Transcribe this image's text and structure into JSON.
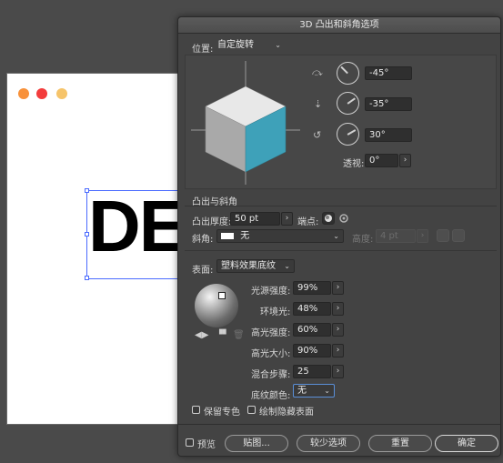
{
  "artboard": {
    "dot_colors": [
      "#f8913a",
      "#f33c3c",
      "#f6c46a"
    ],
    "text": "DE"
  },
  "dialog": {
    "title": "3D 凸出和斜角选项",
    "position": {
      "label": "位置:",
      "preset": "自定旋转",
      "x_rotation": "-45°",
      "y_rotation": "-35°",
      "z_rotation": "30°",
      "perspective_label": "透视:",
      "perspective": "0°"
    },
    "extrude": {
      "section_title": "凸出与斜角",
      "depth_label": "凸出厚度:",
      "depth": "50 pt",
      "cap_label": "端点:",
      "bevel_label": "斜角:",
      "bevel": "无",
      "height_label": "高度:",
      "height": "4 pt"
    },
    "surface": {
      "label": "表面:",
      "preset": "塑料效果底纹",
      "light_intensity_label": "光源强度:",
      "light_intensity": "99%",
      "ambient_label": "环境光:",
      "ambient": "48%",
      "highlight_intensity_label": "高光强度:",
      "highlight_intensity": "60%",
      "highlight_size_label": "高光大小:",
      "highlight_size": "90%",
      "blend_steps_label": "混合步骤:",
      "blend_steps": "25",
      "shading_color_label": "底纹颜色:",
      "shading_color": "无",
      "preserve_spot_label": "保留专色",
      "draw_hidden_label": "绘制隐藏表面"
    },
    "footer": {
      "preview_label": "预览",
      "map_art": "贴图...",
      "fewer_options": "较少选项",
      "reset": "重置",
      "ok": "确定"
    },
    "colors": {
      "cube_top": "#e8e8e8",
      "cube_left": "#a9a9a9",
      "cube_right": "#3ea1b9"
    }
  }
}
